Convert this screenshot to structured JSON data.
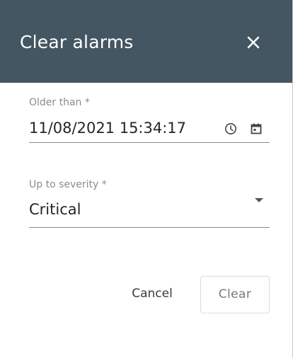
{
  "dialog": {
    "title": "Clear alarms",
    "close_icon": "close-icon"
  },
  "form": {
    "older_than": {
      "label": "Older than *",
      "value": "11/08/2021 15:34:17",
      "icons": [
        "clock-icon",
        "calendar-icon"
      ]
    },
    "severity": {
      "label": "Up to severity *",
      "value": "Critical",
      "icon": "chevron-down-icon"
    }
  },
  "actions": {
    "cancel_label": "Cancel",
    "clear_label": "Clear"
  },
  "colors": {
    "header_background": "#435661",
    "header_text": "#ffffff",
    "label_text": "#8c8c8c",
    "value_text": "#262626"
  }
}
